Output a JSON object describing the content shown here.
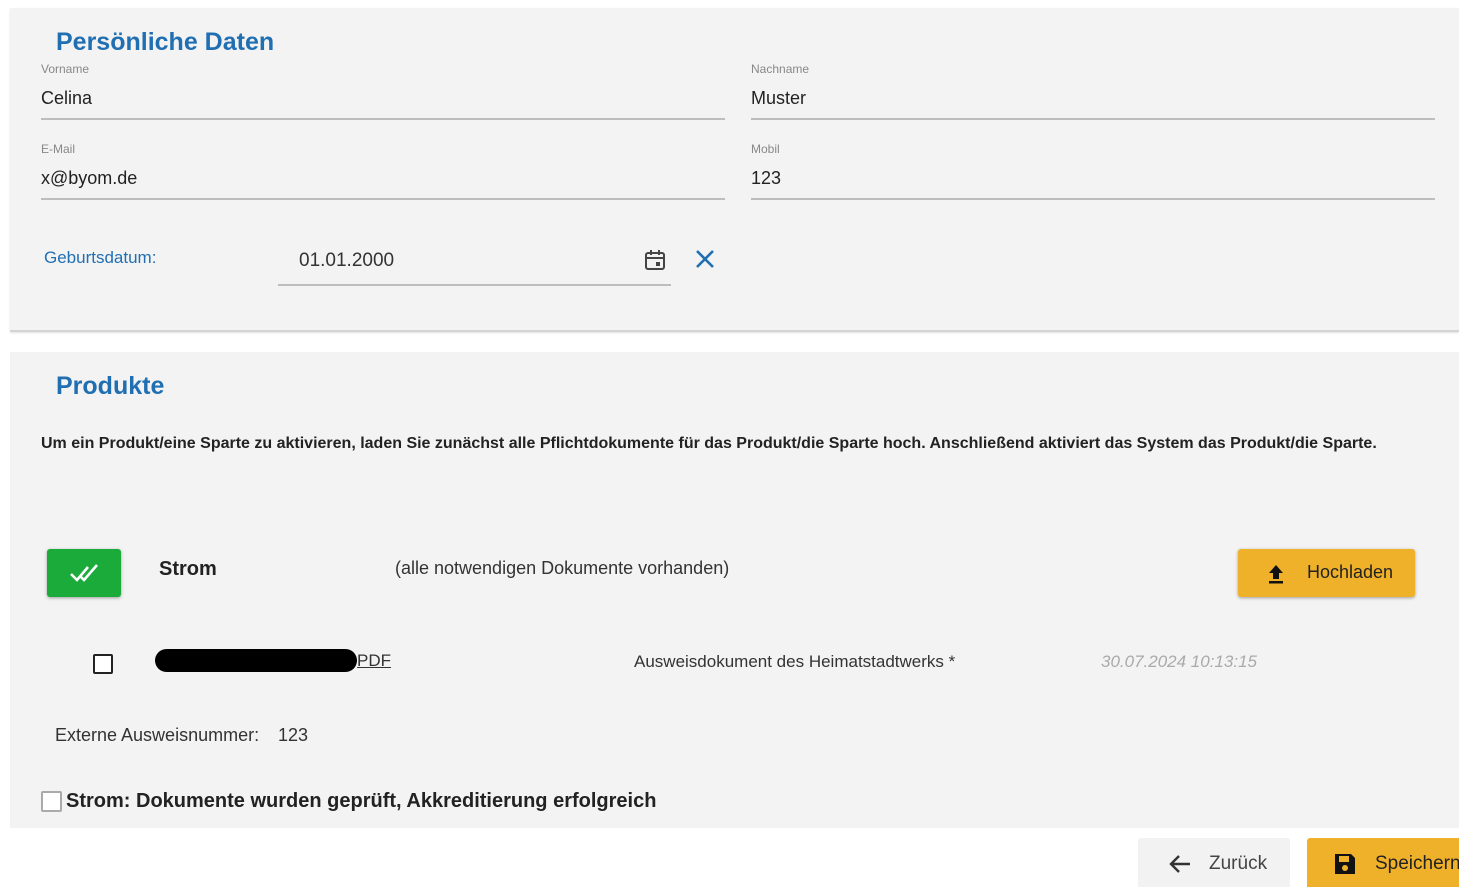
{
  "personal": {
    "title": "Persönliche Daten",
    "first_name": {
      "label": "Vorname",
      "value": "Celina"
    },
    "last_name": {
      "label": "Nachname",
      "value": "Muster"
    },
    "email": {
      "label": "E-Mail",
      "value": "x@byom.de"
    },
    "mobile": {
      "label": "Mobil",
      "value": "123"
    },
    "birthdate": {
      "label": "Geburtsdatum:",
      "value": "01.01.2000"
    }
  },
  "products": {
    "title": "Produkte",
    "info": "Um ein Produkt/eine Sparte zu aktivieren, laden Sie zunächst alle Pflichtdokumente für das Produkt/die Sparte hoch. Anschließend aktiviert das System das Produkt/die Sparte.",
    "product": {
      "name": "Strom",
      "status": "(alle notwendigen Dokumente vorhanden)",
      "upload_label": "Hochladen",
      "status_color": "#1aab3a"
    },
    "document": {
      "link_suffix": "PDF",
      "type": "Ausweisdokument des Heimatstadtwerks *",
      "date": "30.07.2024 10:13:15"
    },
    "external_id": {
      "label": "Externe Ausweisnummer:",
      "value": "123"
    },
    "accreditation_label": "Strom: Dokumente wurden geprüft, Akkreditierung erfolgreich"
  },
  "footer": {
    "back_label": "Zurück",
    "save_label": "Speichern",
    "accent_color": "#f0b12a"
  },
  "colors": {
    "primary": "#1f6fb2",
    "panel_bg": "#f3f3f3"
  }
}
